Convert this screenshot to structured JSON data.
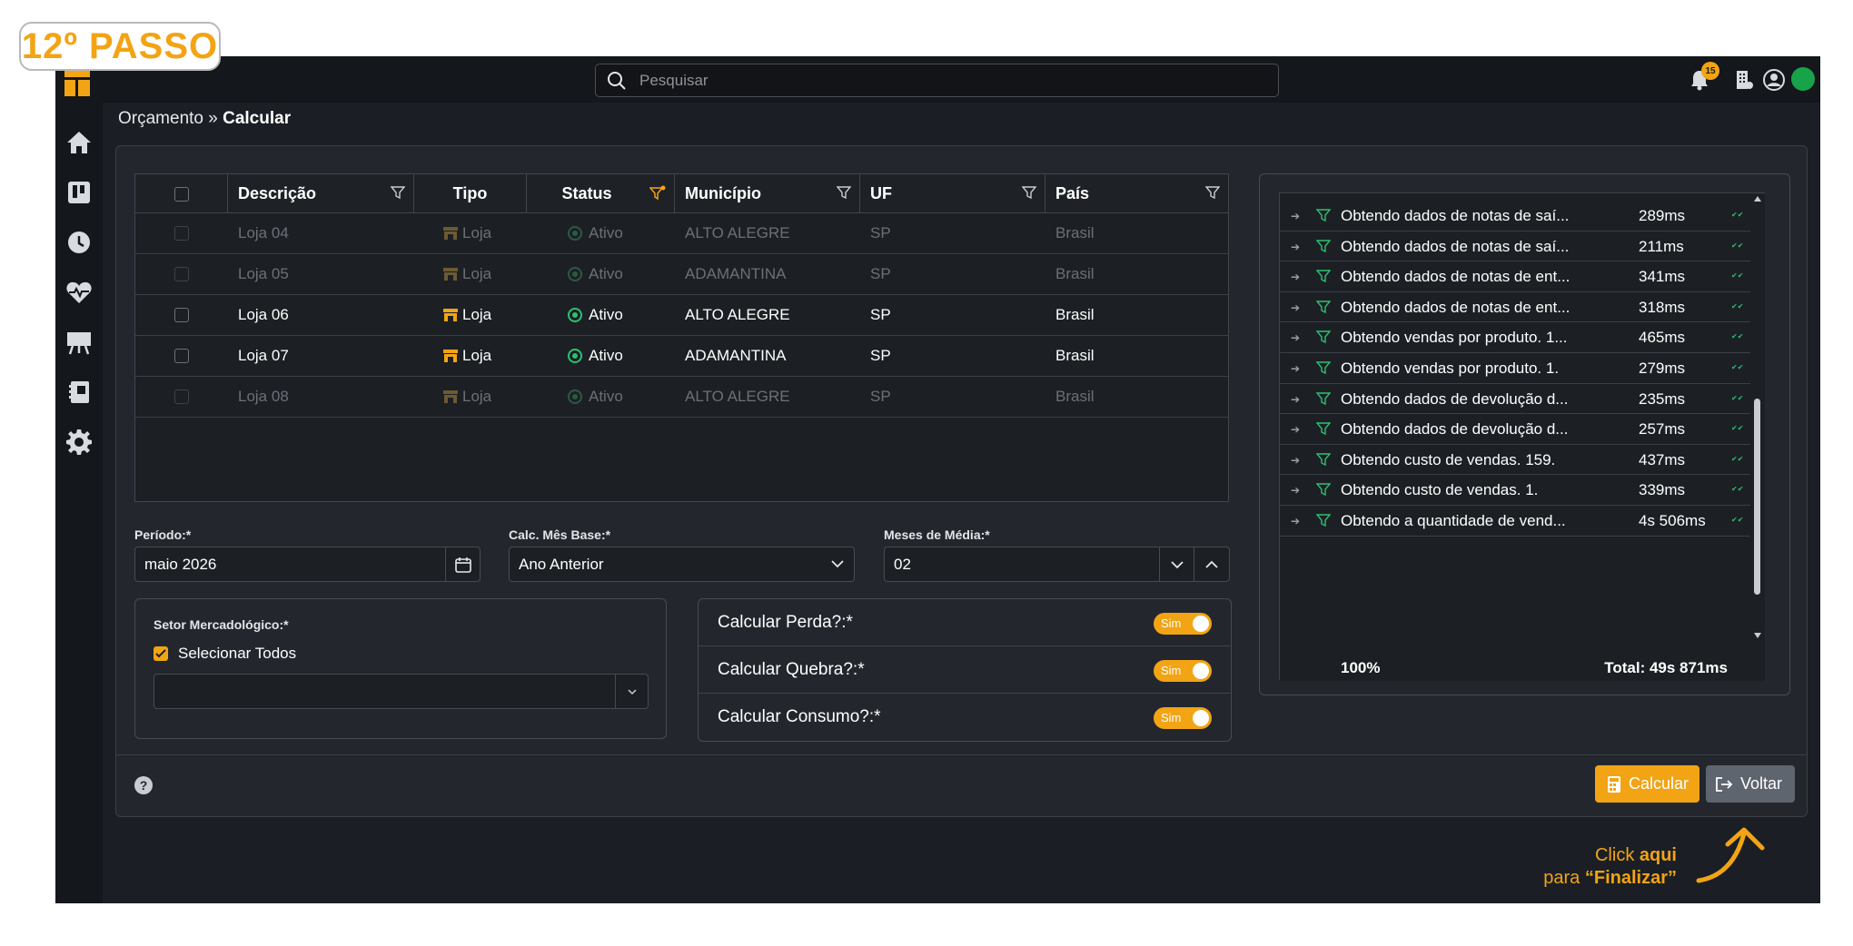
{
  "step_badge": "12º PASSO",
  "search": {
    "placeholder": "Pesquisar"
  },
  "topbar": {
    "notifications_count": "15"
  },
  "breadcrumb": {
    "parent": "Orçamento",
    "separator": " » ",
    "current": "Calcular"
  },
  "table": {
    "headers": {
      "descricao": "Descrição",
      "tipo": "Tipo",
      "status": "Status",
      "municipio": "Município",
      "uf": "UF",
      "pais": "País"
    },
    "rows": [
      {
        "descricao": "Loja 04",
        "tipo": "Loja",
        "status": "Ativo",
        "municipio": "ALTO ALEGRE",
        "uf": "SP",
        "pais": "Brasil"
      },
      {
        "descricao": "Loja 05",
        "tipo": "Loja",
        "status": "Ativo",
        "municipio": "ADAMANTINA",
        "uf": "SP",
        "pais": "Brasil"
      },
      {
        "descricao": "Loja 06",
        "tipo": "Loja",
        "status": "Ativo",
        "municipio": "ALTO ALEGRE",
        "uf": "SP",
        "pais": "Brasil"
      },
      {
        "descricao": "Loja 07",
        "tipo": "Loja",
        "status": "Ativo",
        "municipio": "ADAMANTINA",
        "uf": "SP",
        "pais": "Brasil"
      },
      {
        "descricao": "Loja 08",
        "tipo": "Loja",
        "status": "Ativo",
        "municipio": "ALTO ALEGRE",
        "uf": "SP",
        "pais": "Brasil"
      }
    ]
  },
  "form": {
    "periodo_label": "Período:*",
    "periodo_value": "maio 2026",
    "calc_mes_label": "Calc. Mês Base:*",
    "calc_mes_value": "Ano Anterior",
    "meses_label": "Meses de Média:*",
    "meses_value": "02",
    "setor_label": "Setor Mercadológico:*",
    "selecionar_todos": "Selecionar Todos",
    "toggles": [
      {
        "label": "Calcular Perda?:*",
        "value": "Sim"
      },
      {
        "label": "Calcular Quebra?:*",
        "value": "Sim"
      },
      {
        "label": "Calcular Consumo?:*",
        "value": "Sim"
      }
    ]
  },
  "log": {
    "rows": [
      {
        "text": "Obtendo dados de notas de saí...",
        "time": "289ms"
      },
      {
        "text": "Obtendo dados de notas de saí...",
        "time": "211ms"
      },
      {
        "text": "Obtendo dados de notas de ent...",
        "time": "341ms"
      },
      {
        "text": "Obtendo dados de notas de ent...",
        "time": "318ms"
      },
      {
        "text": "Obtendo vendas por produto. 1...",
        "time": "465ms"
      },
      {
        "text": "Obtendo vendas por produto. 1.",
        "time": "279ms"
      },
      {
        "text": "Obtendo dados de devolução d...",
        "time": "235ms"
      },
      {
        "text": "Obtendo dados de devolução d...",
        "time": "257ms"
      },
      {
        "text": "Obtendo custo de vendas. 159.",
        "time": "437ms"
      },
      {
        "text": "Obtendo custo de vendas. 1.",
        "time": "339ms"
      },
      {
        "text": "Obtendo a quantidade de vend...",
        "time": "4s 506ms"
      }
    ],
    "footer_percent": "100%",
    "footer_total": "Total: 49s 871ms"
  },
  "buttons": {
    "calcular": "Calcular",
    "voltar": "Voltar",
    "help": "?"
  },
  "callout": {
    "line1_prefix": "Click ",
    "line1_bold": "aqui",
    "line2_prefix": "para ",
    "line2_bold": "“Finalizar”"
  },
  "colors": {
    "accent": "#f2a415",
    "success": "#2fbf71",
    "background": "#1b1f25"
  }
}
